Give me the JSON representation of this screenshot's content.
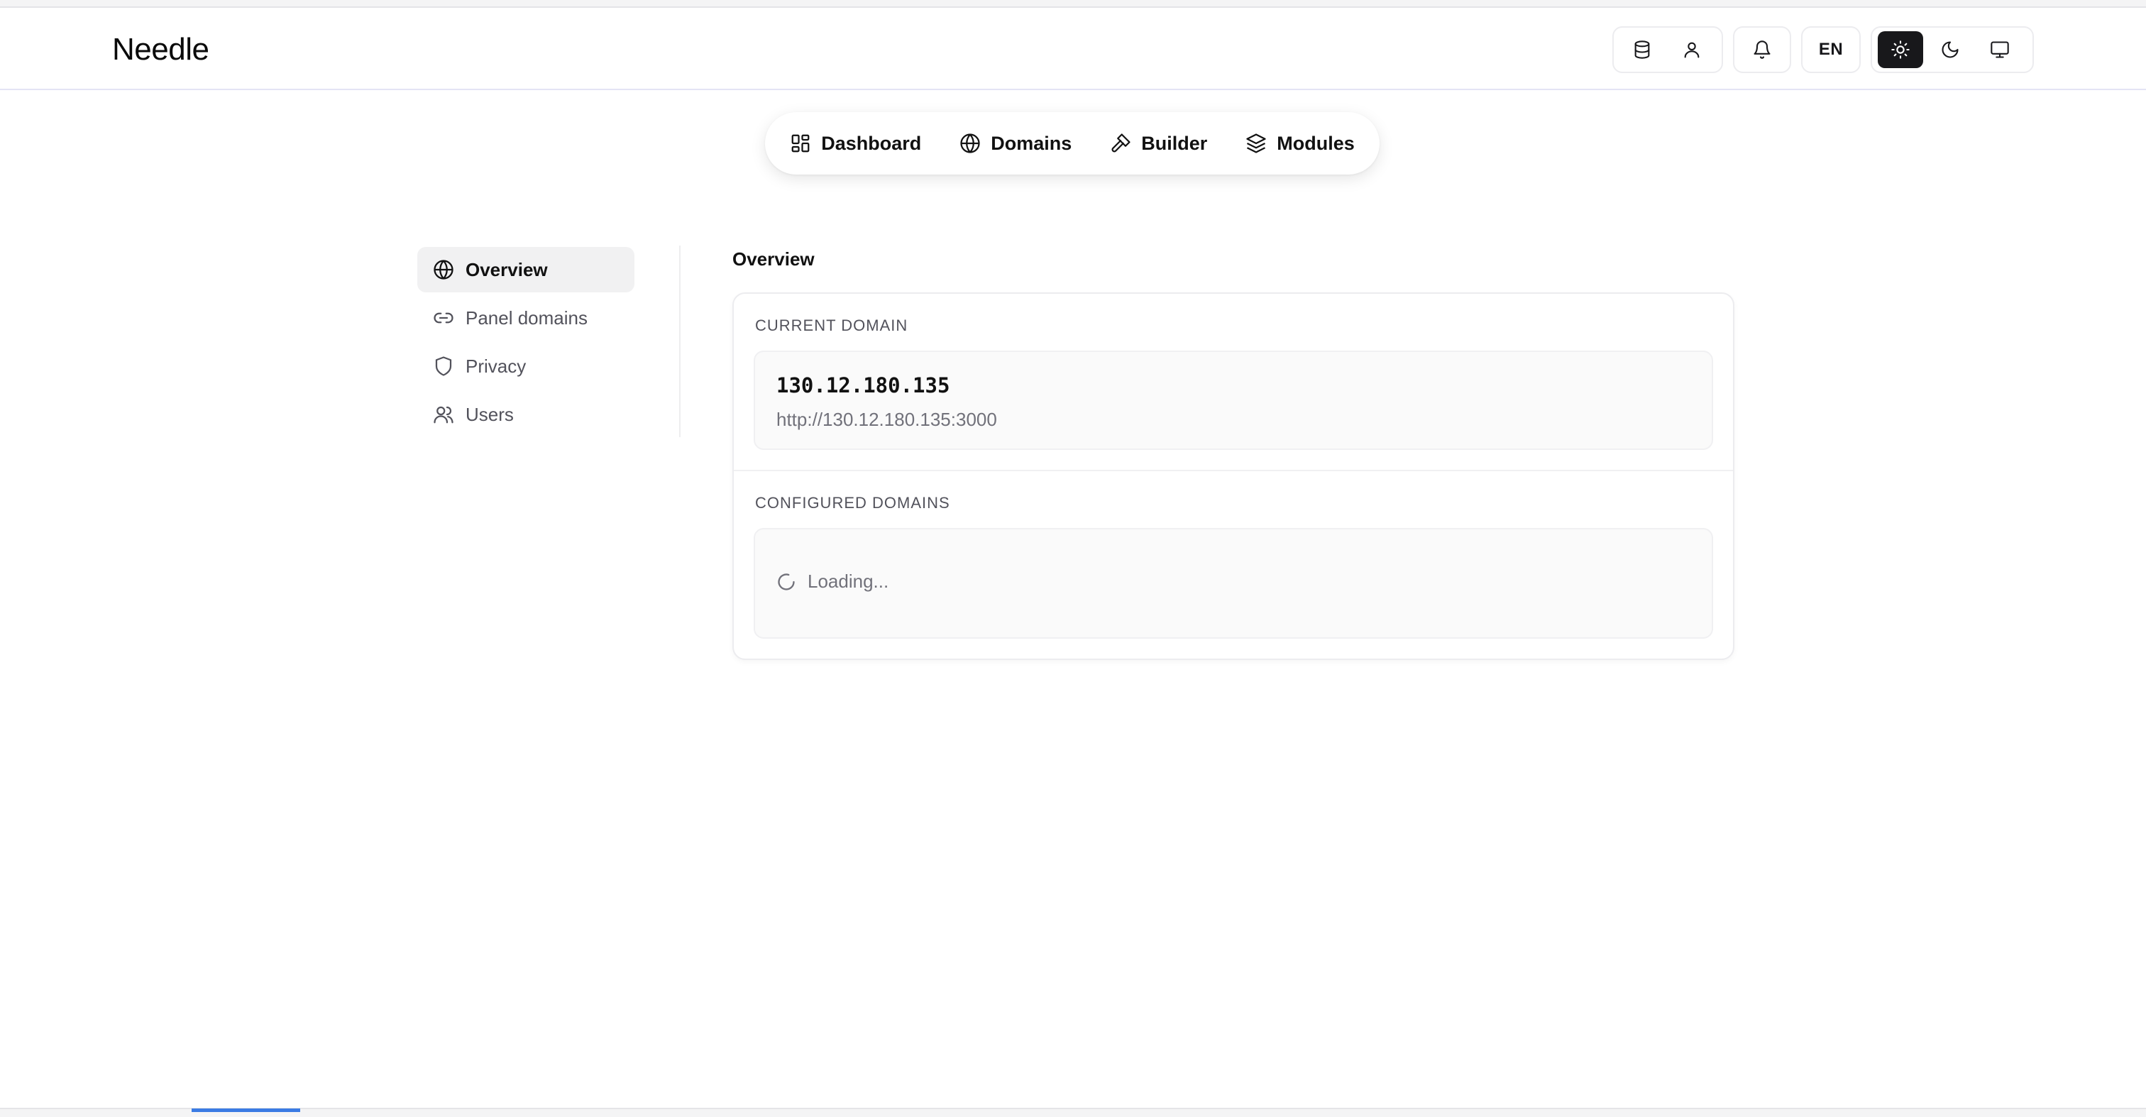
{
  "app": {
    "brand": "Needle"
  },
  "header": {
    "language": "EN",
    "icons": [
      "database-icon",
      "user-icon",
      "bell-icon",
      "sun-icon",
      "moon-icon",
      "monitor-icon"
    ],
    "active_theme": "light"
  },
  "nav": {
    "items": [
      {
        "label": "Dashboard",
        "icon": "grid-icon"
      },
      {
        "label": "Domains",
        "icon": "globe-icon"
      },
      {
        "label": "Builder",
        "icon": "hammer-icon"
      },
      {
        "label": "Modules",
        "icon": "layers-icon"
      }
    ]
  },
  "sidebar": {
    "items": [
      {
        "label": "Overview",
        "icon": "globe-icon",
        "active": true
      },
      {
        "label": "Panel domains",
        "icon": "link-icon"
      },
      {
        "label": "Privacy",
        "icon": "shield-icon"
      },
      {
        "label": "Users",
        "icon": "users-icon"
      }
    ]
  },
  "main": {
    "title": "Overview",
    "current_domain": {
      "label": "CURRENT DOMAIN",
      "ip": "130.12.180.135",
      "url": "http://130.12.180.135:3000"
    },
    "configured_domains": {
      "label": "CONFIGURED DOMAINS",
      "status": "Loading..."
    }
  },
  "colors": {
    "accent": "#18181b",
    "progress": "#3b7be4",
    "muted": "#71717a"
  }
}
